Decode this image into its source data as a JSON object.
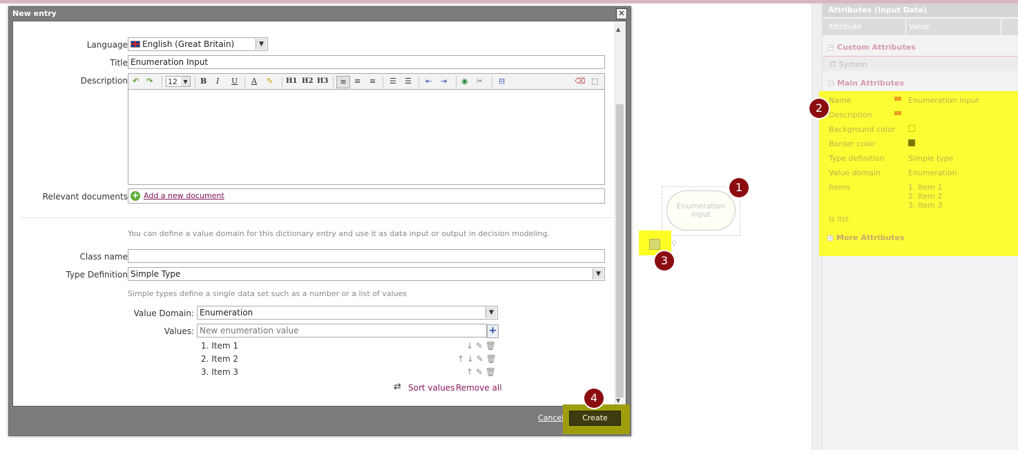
{
  "dialog": {
    "title": "New entry",
    "close_glyph": "✕",
    "language_label": "Language:",
    "language_value": "English (Great Britain)",
    "title_label": "Title:",
    "title_value": "Enumeration Input",
    "description_label": "Description:",
    "toolbar": {
      "font_size": "12",
      "bold": "B",
      "italic": "I",
      "underline": "U",
      "font_color": "A",
      "h1": "H1",
      "h2": "H2",
      "h3": "H3"
    },
    "relevant_docs_label": "Relevant documents:",
    "add_document_link": "Add a new document",
    "value_domain_help": "You can define a value domain for this dictionary entry and use it as data input or output in decision modeling.",
    "class_name_label": "Class name:",
    "class_name_value": "",
    "type_def_label": "Type Definition:",
    "type_def_value": "Simple Type",
    "simple_types_help": "Simple types define a single data set such as a number or a list of values",
    "value_domain_label": "Value Domain:",
    "value_domain_value": "Enumeration",
    "values_label": "Values:",
    "values_placeholder": "New enumeration value",
    "items": [
      "1. Item 1",
      "2. Item 2",
      "3. Item 3"
    ],
    "sort_values": "Sort values",
    "remove_all": "Remove all",
    "cancel": "Cancel",
    "create": "Create"
  },
  "canvas": {
    "node_label": "Enumeration input"
  },
  "badges": [
    "1",
    "2",
    "3",
    "4"
  ],
  "attributes_panel": {
    "title": "Attributes (Input Data)",
    "col_attribute": "Attribute",
    "col_value": "Value",
    "custom_section": "Custom Attributes",
    "custom_rows": [
      {
        "key": "IT System",
        "value": ""
      }
    ],
    "main_section": "Main Attributes",
    "main_rows": [
      {
        "key": "Name",
        "value": "Enumeration input"
      },
      {
        "key": "Description",
        "value": ""
      },
      {
        "key": "Background color",
        "value": ""
      },
      {
        "key": "Border color",
        "value": ""
      },
      {
        "key": "Type definition",
        "value": "Simple type"
      },
      {
        "key": "Value domain",
        "value": "Enumeration"
      },
      {
        "key": "Items",
        "value": [
          "1. Item 1",
          "2. Item 2",
          "3. Item 3"
        ]
      },
      {
        "key": "Is list",
        "value": ""
      }
    ],
    "more_section": "More Attributes"
  },
  "colors": {
    "highlight": "#ffff00",
    "badge": "#8b0d10",
    "section_text": "#d59bb6",
    "border_color_swatch": "#7a7a00"
  }
}
